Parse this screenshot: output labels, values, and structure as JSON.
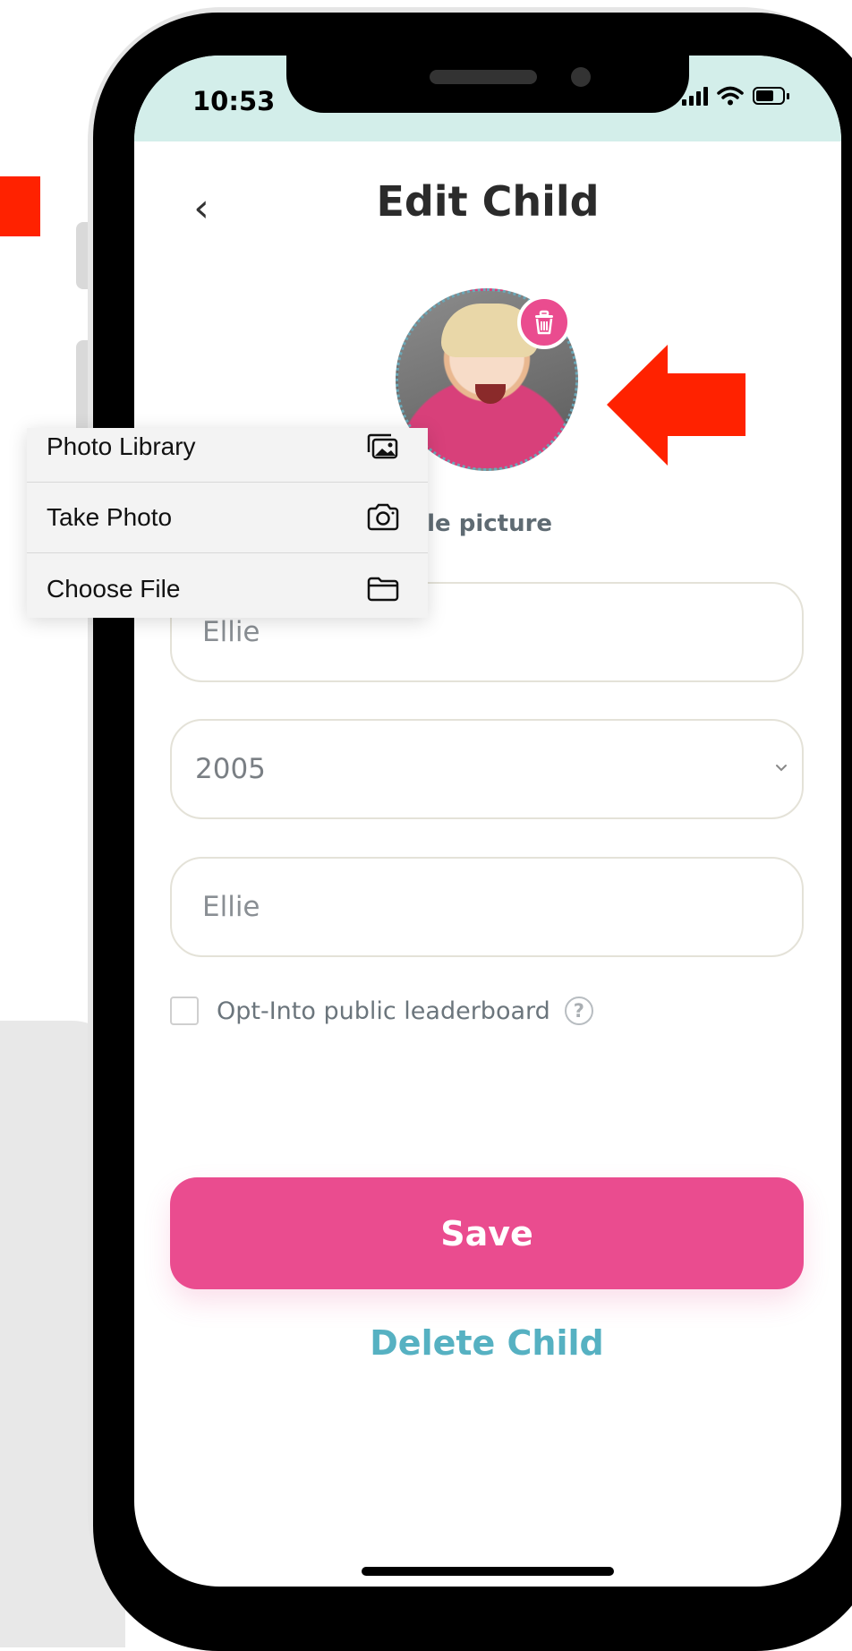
{
  "status_bar": {
    "time": "10:53"
  },
  "header": {
    "title": "Edit Child",
    "back_icon": "‹"
  },
  "profile": {
    "label": "ofile picture"
  },
  "popup_menu": {
    "items": [
      {
        "label": "Photo Library",
        "icon": "photo-library-icon"
      },
      {
        "label": "Take Photo",
        "icon": "camera-icon"
      },
      {
        "label": "Choose File",
        "icon": "folder-icon"
      }
    ]
  },
  "form": {
    "name_value": "Ellie",
    "birth_year_value": "2005",
    "display_name_value": "Ellie",
    "leaderboard_label": "Opt-Into public leaderboard",
    "help_glyph": "?"
  },
  "actions": {
    "save_label": "Save",
    "delete_label": "Delete Child"
  },
  "colors": {
    "accent": "#ea4c8f",
    "link": "#56b1c2",
    "status_bg": "#d3eeea",
    "annotation_red": "#ff2200"
  }
}
